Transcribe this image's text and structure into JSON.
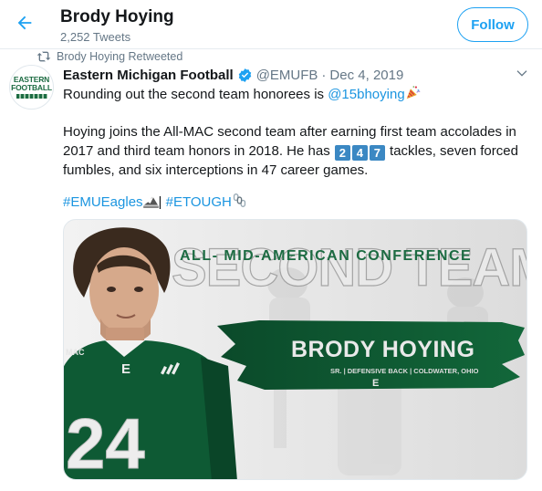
{
  "header": {
    "title": "Brody Hoying",
    "tweet_count": "2,252 Tweets",
    "follow_label": "Follow"
  },
  "retweet": {
    "label": "Brody Hoying Retweeted"
  },
  "tweet": {
    "author_name": "Eastern Michigan Football",
    "handle": "@EMUFB",
    "separator": "·",
    "date": "Dec 4, 2019",
    "avatar_lines": [
      "EASTERN",
      "FOOTBALL"
    ],
    "line1_prefix": "Rounding out the second team honorees is ",
    "mention": "@15bhoying",
    "p2_part1": "Hoying joins the All-MAC second team after earning first team accolades in 2017 and third team honors in 2018. He has ",
    "keycaps": [
      "2",
      "4",
      "7"
    ],
    "p2_part2": " tackles, seven forced fumbles, and six interceptions in 47 career games.",
    "hashtag1": "#EMUEagles",
    "tag_separator": "| ",
    "hashtag2": "#ETOUGH"
  },
  "media": {
    "heading_big": "SECOND TEAM",
    "heading_small": "ALL- MID-AMERICAN CONFERENCE",
    "player_name": "BRODY HOYING",
    "player_details": "SR. | DEFENSIVE BACK | COLDWATER, OHIO",
    "jersey_number": "24",
    "jersey_letter": "E",
    "sleeve_badge": "MAC",
    "logo_letter": "E"
  },
  "colors": {
    "accent": "#1da1f2",
    "link": "#1b95e0",
    "muted": "#657786",
    "emu_green": "#0e5a34"
  },
  "icons": [
    "back-arrow-icon",
    "retweet-icon",
    "verified-badge-icon",
    "chevron-down-icon",
    "party-popper-icon",
    "eagle-icon",
    "chain-icon"
  ]
}
